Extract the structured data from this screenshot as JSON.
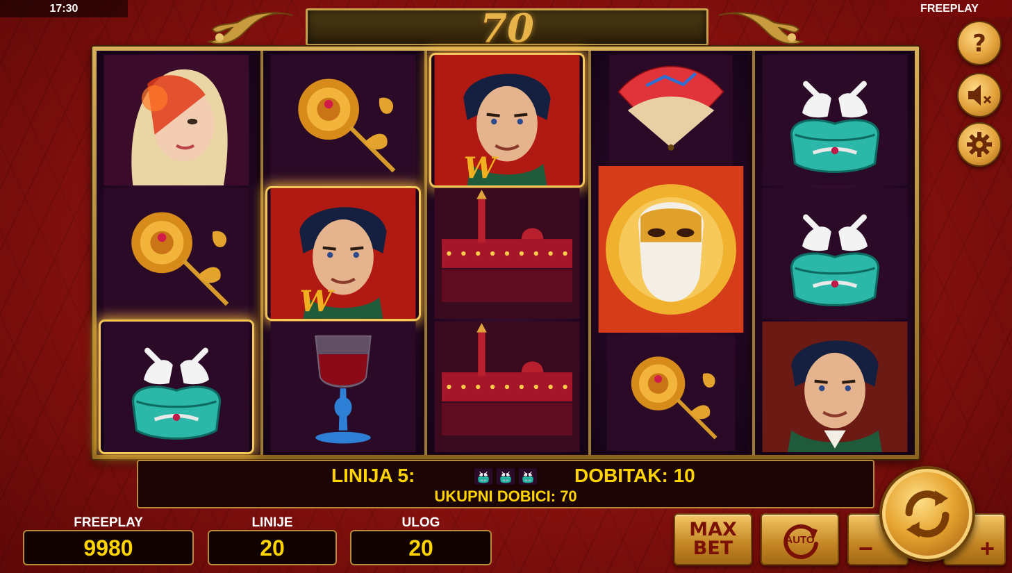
{
  "status_bar": {
    "time": "17:30",
    "mode": "FREEPLAY"
  },
  "win_banner": {
    "value": "70"
  },
  "reels": [
    [
      "woman-masked",
      "rose",
      "doves-box"
    ],
    [
      "rose",
      "man-wild",
      "wine-glass"
    ],
    [
      "man-wild",
      "venice",
      "venice"
    ],
    [
      "fan",
      "golden-mask",
      "rose"
    ],
    [
      "doves-box",
      "doves-box",
      "man"
    ]
  ],
  "winning_cells": [
    [
      0,
      2
    ],
    [
      1,
      1
    ],
    [
      2,
      0
    ]
  ],
  "win_info": {
    "line_label": "LINIJA 5:",
    "win_label": "DOBITAK: 10",
    "total_label": "UKUPNI DOBICI: 70",
    "line_symbol": "doves-box",
    "line_symbol_count": 3
  },
  "balance": {
    "label": "FREEPLAY",
    "value": "9980"
  },
  "lines": {
    "label": "LINIJE",
    "value": "20"
  },
  "bet": {
    "label": "ULOG",
    "value": "20"
  },
  "buttons": {
    "max_bet_line1": "MAX",
    "max_bet_line2": "BET",
    "auto": "AUTO",
    "minus": "−",
    "plus": "+"
  },
  "side_icons": [
    "help-icon",
    "sound-muted-icon",
    "settings-gear-icon"
  ],
  "colors": {
    "accent_gold": "#e8b44a",
    "text_yellow": "#ffd400",
    "background_red": "#8e130f"
  }
}
